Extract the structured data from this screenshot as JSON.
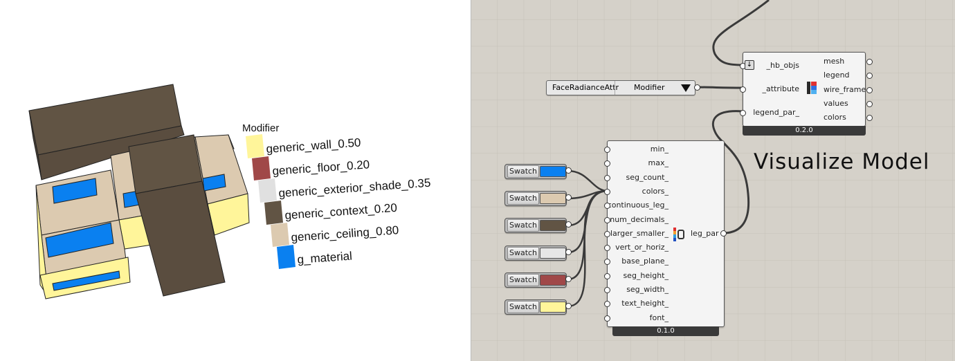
{
  "viewport": {
    "legend_title": "Modifier",
    "legend_items": [
      {
        "label": "generic_wall_0.50",
        "color": "#fff59a"
      },
      {
        "label": "generic_floor_0.20",
        "color": "#a04848"
      },
      {
        "label": "generic_exterior_shade_0.35",
        "color": "#e0e0e0"
      },
      {
        "label": "generic_context_0.20",
        "color": "#615444"
      },
      {
        "label": "generic_ceiling_0.80",
        "color": "#dccab0"
      },
      {
        "label": "g_material",
        "color": "#0a80f0"
      }
    ]
  },
  "canvas": {
    "title": "Visualize Model",
    "panel": {
      "text": "FaceRadianceAttr",
      "value": "Modifier"
    },
    "visualize_component": {
      "inputs": [
        "_hb_objs",
        "_attribute",
        "legend_par_"
      ],
      "outputs": [
        "mesh",
        "legend",
        "wire_frame",
        "values",
        "colors"
      ],
      "version": "0.2.0",
      "icon": "visualize-attribute-icon"
    },
    "legend_par_component": {
      "inputs": [
        "min_",
        "max_",
        "seg_count_",
        "colors_",
        "continuous_leg_",
        "num_decimals_",
        "larger_smaller_",
        "vert_or_horiz_",
        "base_plane_",
        "seg_height_",
        "seg_width_",
        "text_height_",
        "font_"
      ],
      "outputs": [
        "leg_par"
      ],
      "version": "0.1.0",
      "icon": "legend-parameters-icon"
    },
    "swatches": [
      {
        "label": "Swatch",
        "color": "#0a80f0"
      },
      {
        "label": "Swatch",
        "color": "#dccab0"
      },
      {
        "label": "Swatch",
        "color": "#615444"
      },
      {
        "label": "Swatch",
        "color": "#e6e6e6"
      },
      {
        "label": "Swatch",
        "color": "#a04848"
      },
      {
        "label": "Swatch",
        "color": "#fff59a"
      }
    ]
  }
}
